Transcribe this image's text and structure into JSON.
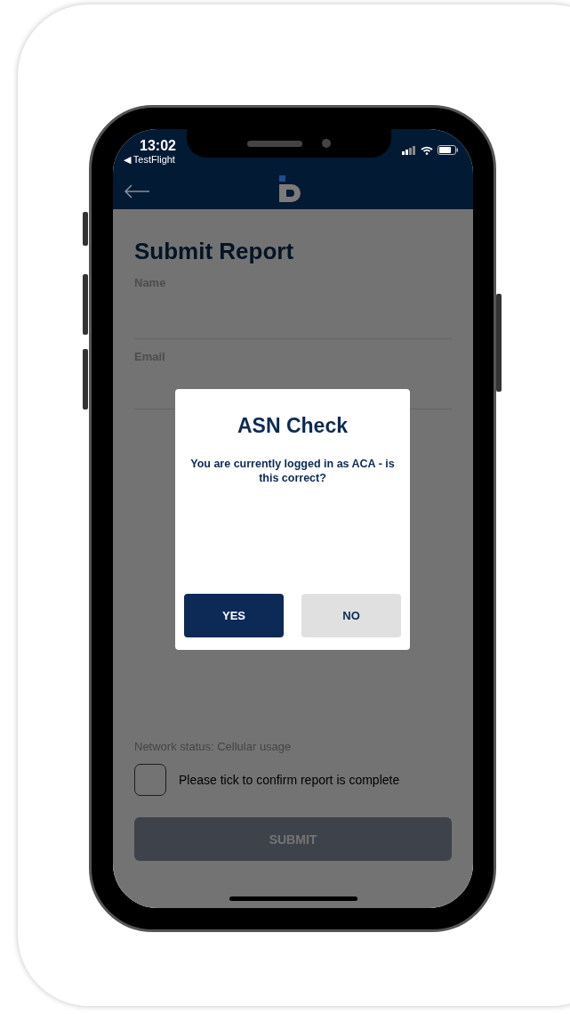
{
  "status_bar": {
    "time": "13:02",
    "back_app": "◀ TestFlight"
  },
  "form": {
    "title": "Submit Report",
    "fields": [
      {
        "label": "Name"
      },
      {
        "label": "Email"
      }
    ],
    "network_status": "Network status: Cellular usage",
    "confirm": {
      "label": "Please tick to confirm report is complete",
      "checked": false
    },
    "submit": {
      "label": "SUBMIT",
      "disabled": true
    }
  },
  "dialog": {
    "title": "ASN Check",
    "message": "You are currently logged in as ACA - is this correct?",
    "buttons": [
      {
        "label": "YES",
        "kind": "primary"
      },
      {
        "label": "NO",
        "kind": "secondary"
      }
    ]
  }
}
